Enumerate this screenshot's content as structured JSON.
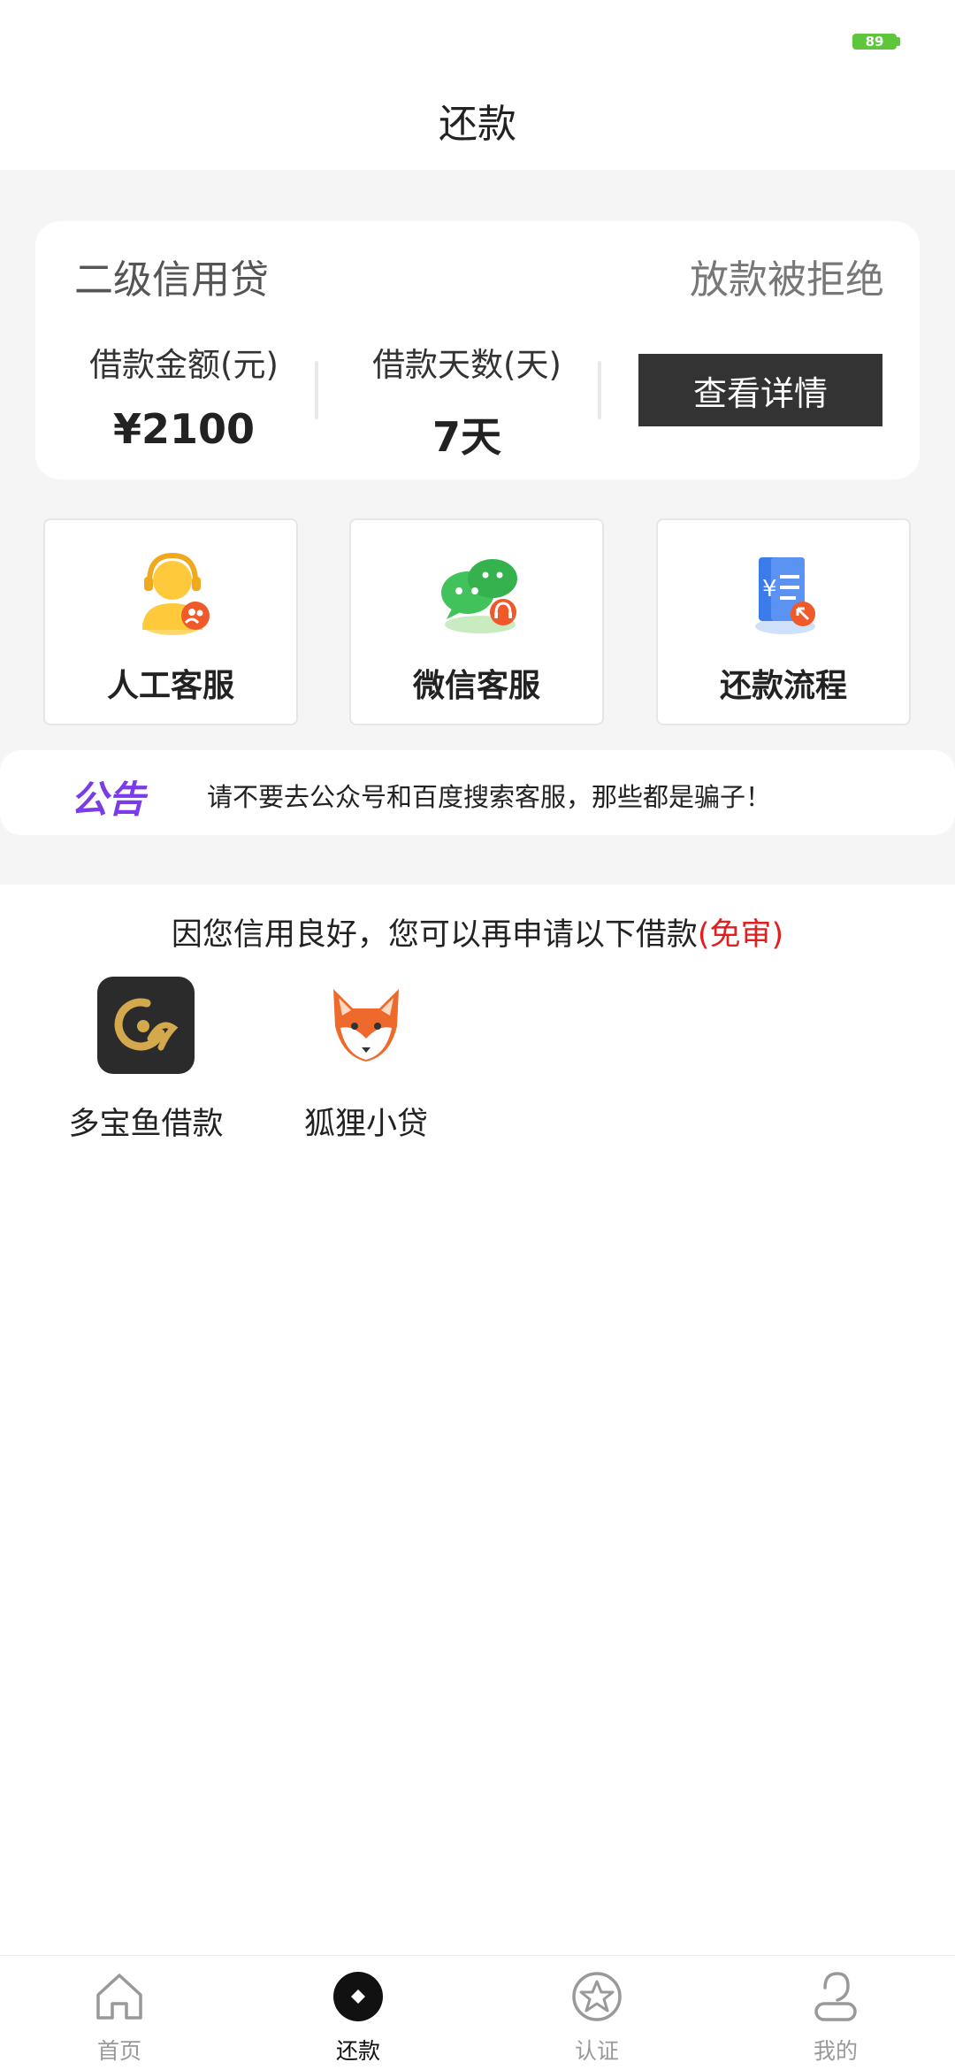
{
  "status_bar": {
    "battery": "89"
  },
  "header": {
    "title": "还款"
  },
  "loan_card": {
    "product_name": "二级信用贷",
    "status": "放款被拒绝",
    "amount_label": "借款金额(元)",
    "amount_value": "¥2100",
    "days_label": "借款天数(天)",
    "days_value": "7天",
    "detail_button": "查看详情"
  },
  "services": [
    {
      "label": "人工客服",
      "icon": "agent-headset-icon"
    },
    {
      "label": "微信客服",
      "icon": "wechat-icon"
    },
    {
      "label": "还款流程",
      "icon": "repayment-document-icon"
    }
  ],
  "notice": {
    "badge": "公告",
    "text": "请不要去公众号和百度搜索客服，那些都是骗子！"
  },
  "recommend": {
    "title_prefix": "因您信用良好，您可以再申请以下借款",
    "title_highlight": "(免审)",
    "apps": [
      {
        "name": "多宝鱼借款",
        "icon": "duobaoyu-logo-icon"
      },
      {
        "name": "狐狸小贷",
        "icon": "fox-logo-icon"
      }
    ]
  },
  "bottom_nav": [
    {
      "label": "首页",
      "icon": "home-icon"
    },
    {
      "label": "还款",
      "icon": "repay-icon",
      "active": true
    },
    {
      "label": "认证",
      "icon": "badge-star-icon"
    },
    {
      "label": "我的",
      "icon": "user-icon"
    }
  ],
  "colors": {
    "accent_dark": "#333333",
    "notice_purple": "#7a3be8",
    "highlight_red": "#e02020",
    "battery_green": "#5ec63b"
  }
}
